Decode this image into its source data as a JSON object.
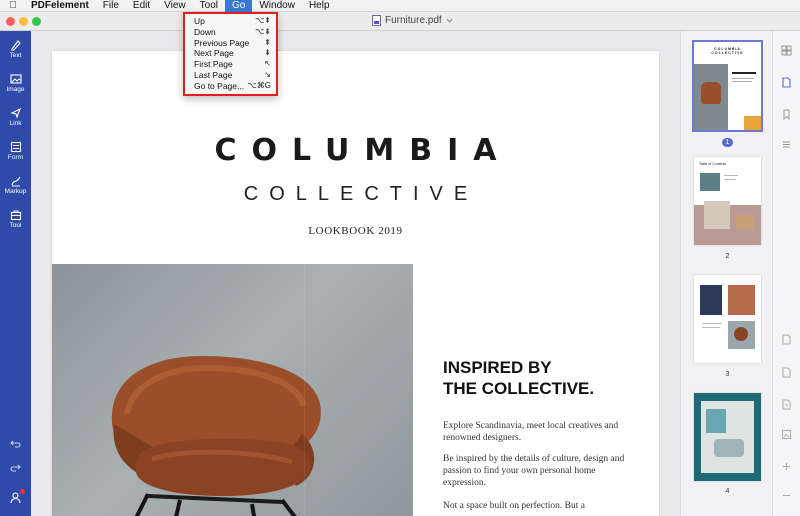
{
  "menubar": {
    "app_name": "PDFelement",
    "items": [
      "File",
      "Edit",
      "View",
      "Tool",
      "Go",
      "Window",
      "Help"
    ],
    "active": "Go"
  },
  "window": {
    "document_title": "Furniture.pdf"
  },
  "go_menu": {
    "items": [
      {
        "label": "Up",
        "shortcut": "⌥⇞"
      },
      {
        "label": "Down",
        "shortcut": "⌥⇟"
      },
      {
        "label": "Previous Page",
        "shortcut": "⇞"
      },
      {
        "label": "Next Page",
        "shortcut": "⇟"
      },
      {
        "label": "First Page",
        "shortcut": "↖"
      },
      {
        "label": "Last Page",
        "shortcut": "↘"
      },
      {
        "label": "Go to Page...",
        "shortcut": "⌥⌘G"
      }
    ]
  },
  "left_tools": [
    {
      "label": "Text",
      "icon": "text-edit-icon"
    },
    {
      "label": "Image",
      "icon": "image-icon"
    },
    {
      "label": "Link",
      "icon": "link-icon"
    },
    {
      "label": "Form",
      "icon": "form-icon"
    },
    {
      "label": "Markup",
      "icon": "markup-icon"
    },
    {
      "label": "Tool",
      "icon": "toolbox-icon"
    }
  ],
  "document": {
    "title_line1": "COLUMBIA",
    "title_line2": "COLLECTIVE",
    "subtitle": "LOOKBOOK 2019",
    "heading_line1": "INSPIRED BY",
    "heading_line2": "THE COLLECTIVE.",
    "para1": "Explore Scandinavia, meet local creatives and renowned designers.",
    "para2": "Be inspired by the details of culture, design and passion to find your own personal home expression.",
    "para3": "Not a space built on perfection. But a"
  },
  "thumbnails": {
    "pages": [
      "1",
      "2",
      "3",
      "4"
    ],
    "selected": "1",
    "page1_title": "COLUMBIA COLLECTIVE",
    "page2_title": "Table of Contents"
  },
  "colors": {
    "sidebar": "#2f4aa8",
    "menu_active": "#3b78d4",
    "highlight_box": "#e02020",
    "chair_leather": "#9a4f2a",
    "thumb_selected": "#5a6ad0"
  }
}
